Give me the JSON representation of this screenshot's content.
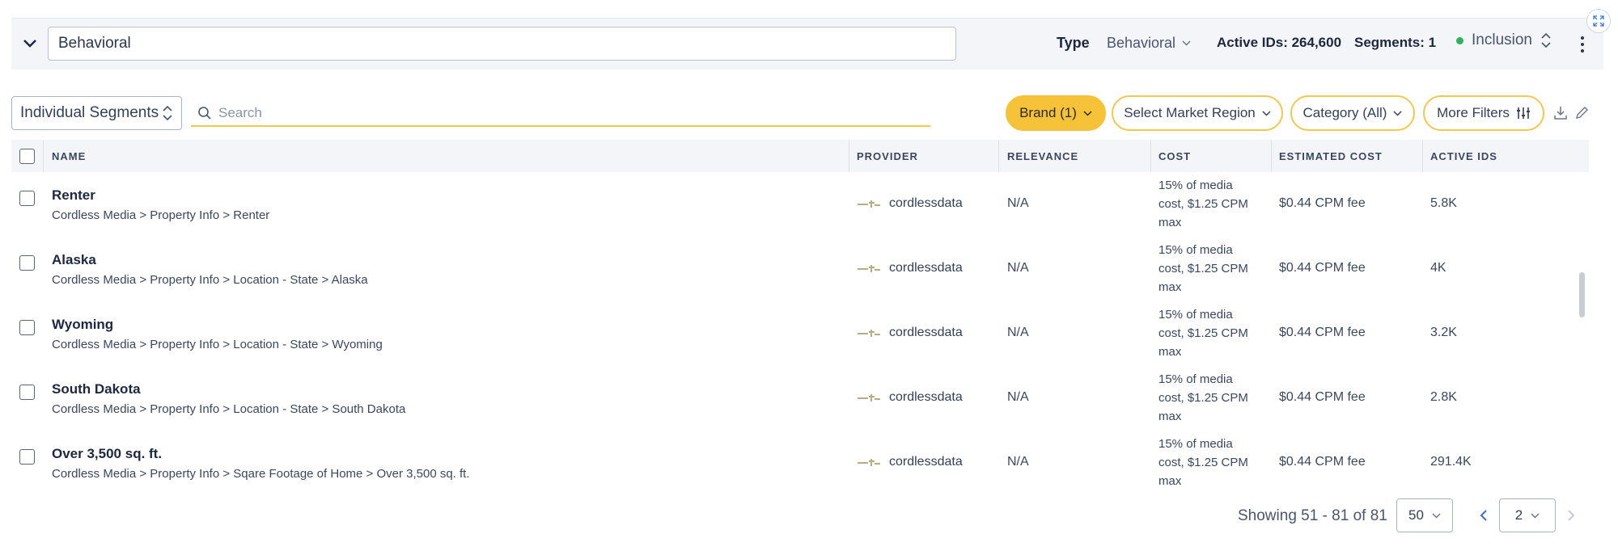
{
  "header": {
    "segment_name_value": "Behavioral",
    "type_label": "Type",
    "type_value": "Behavioral",
    "active_ids": "Active IDs: 264,600",
    "segments": "Segments: 1",
    "inclusion": "Inclusion",
    "inclusion_color": "#2fb35a"
  },
  "toolbar": {
    "segment_mode": "Individual Segments",
    "search_placeholder": "Search",
    "brand_filter": "Brand (1)",
    "market_filter": "Select Market Region",
    "category_filter": "Category (All)",
    "more_filters": "More Filters",
    "accent_color": "#f2c94c"
  },
  "table": {
    "columns": [
      "NAME",
      "PROVIDER",
      "RELEVANCE",
      "COST",
      "ESTIMATED COST",
      "ACTIVE IDS"
    ],
    "rows": [
      {
        "name": "Renter",
        "path": "Cordless Media > Property Info > Renter",
        "provider": "cordlessdata",
        "relevance": "N/A",
        "cost_l1": "15% of media",
        "cost_l2": "cost, $1.25 CPM",
        "cost_l3": "max",
        "estimated_cost": "$0.44 CPM fee",
        "active_ids": "5.8K"
      },
      {
        "name": "Alaska",
        "path": "Cordless Media > Property Info > Location - State > Alaska",
        "provider": "cordlessdata",
        "relevance": "N/A",
        "cost_l1": "15% of media",
        "cost_l2": "cost, $1.25 CPM",
        "cost_l3": "max",
        "estimated_cost": "$0.44 CPM fee",
        "active_ids": "4K"
      },
      {
        "name": "Wyoming",
        "path": "Cordless Media > Property Info > Location - State > Wyoming",
        "provider": "cordlessdata",
        "relevance": "N/A",
        "cost_l1": "15% of media",
        "cost_l2": "cost, $1.25 CPM",
        "cost_l3": "max",
        "estimated_cost": "$0.44 CPM fee",
        "active_ids": "3.2K"
      },
      {
        "name": "South Dakota",
        "path": "Cordless Media > Property Info > Location - State > South Dakota",
        "provider": "cordlessdata",
        "relevance": "N/A",
        "cost_l1": "15% of media",
        "cost_l2": "cost, $1.25 CPM",
        "cost_l3": "max",
        "estimated_cost": "$0.44 CPM fee",
        "active_ids": "2.8K"
      },
      {
        "name": "Over 3,500 sq. ft.",
        "path": "Cordless Media > Property Info > Sqare Footage of Home > Over 3,500 sq. ft.",
        "provider": "cordlessdata",
        "relevance": "N/A",
        "cost_l1": "15% of media",
        "cost_l2": "cost, $1.25 CPM",
        "cost_l3": "max",
        "estimated_cost": "$0.44 CPM fee",
        "active_ids": "291.4K"
      }
    ]
  },
  "pagination": {
    "showing": "Showing 51 - 81 of 81",
    "page_size": "50",
    "current_page": "2"
  }
}
